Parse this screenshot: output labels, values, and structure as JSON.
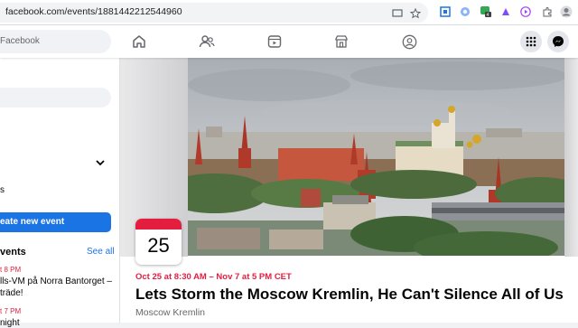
{
  "browser": {
    "url": "facebook.com/events/1881442212544960"
  },
  "fbnav": {
    "search_placeholder": "Facebook"
  },
  "sidebar": {
    "create_event_label": "eate new event",
    "events_heading": "vents",
    "see_all_label": "See all",
    "upcoming": [
      {
        "time": "t 8 PM",
        "line1": "lls-VM på Norra Bantorget –",
        "line2": "träde!"
      },
      {
        "time": "t 7 PM",
        "line1": "night"
      }
    ],
    "fragment_s": "s"
  },
  "event": {
    "day": "25",
    "when": "Oct 25 at 8:30 AM – Nov 7 at 5 PM CET",
    "title": "Lets Storm the Moscow Kremlin, He Can't Silence All of Us",
    "place": "Moscow Kremlin"
  },
  "colors": {
    "brand_blue": "#1b74e4",
    "event_red": "#e41e3f"
  },
  "icons": [
    "screen-cast-icon",
    "star-icon",
    "extension-icon",
    "messenger-icon",
    "grid-menu-icon",
    "home-icon",
    "friends-icon",
    "video-icon",
    "marketplace-icon",
    "groups-icon",
    "chevron-down-icon"
  ]
}
